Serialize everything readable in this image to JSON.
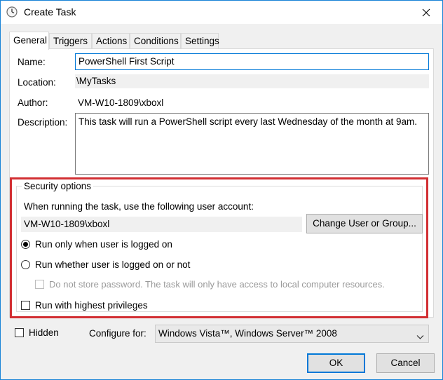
{
  "window": {
    "title": "Create Task",
    "icon": "clock-icon",
    "close_icon": "close-icon"
  },
  "tabs": [
    {
      "label": "General",
      "active": true
    },
    {
      "label": "Triggers"
    },
    {
      "label": "Actions"
    },
    {
      "label": "Conditions"
    },
    {
      "label": "Settings"
    }
  ],
  "general": {
    "name_label": "Name:",
    "name_value": "PowerShell First Script",
    "location_label": "Location:",
    "location_value": "\\MyTasks",
    "author_label": "Author:",
    "author_value": "VM-W10-1809\\xboxl",
    "description_label": "Description:",
    "description_value": "This task will run a PowerShell script every last Wednesday of the month at 9am."
  },
  "security": {
    "title": "Security options",
    "account_prompt": "When running the task, use the following user account:",
    "account_value": "VM-W10-1809\\xboxl",
    "change_button": "Change User or Group...",
    "radio_logged_on": "Run only when user is logged on",
    "radio_whether": "Run whether user is logged on or not",
    "no_store_password": "Do not store password.  The task will only have access to local computer resources.",
    "highest_privileges": "Run with highest privileges"
  },
  "bottom": {
    "hidden_label": "Hidden",
    "configure_label": "Configure for:",
    "configure_value": "Windows Vista™, Windows Server™ 2008"
  },
  "buttons": {
    "ok": "OK",
    "cancel": "Cancel"
  },
  "colors": {
    "accent": "#0078d7",
    "highlight": "#d22f33"
  }
}
